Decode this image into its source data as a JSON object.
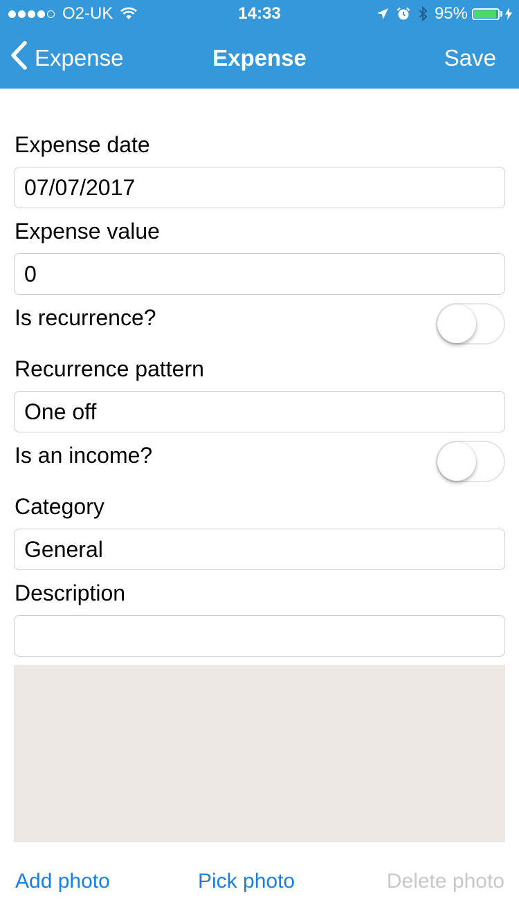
{
  "status_bar": {
    "carrier": "O2-UK",
    "time": "14:33",
    "battery": "95%",
    "battery_level": 0.95,
    "signal_bars": 4,
    "icons": [
      "signal-dots-icon",
      "wifi-icon",
      "location-arrow-icon",
      "alarm-icon",
      "bluetooth-icon",
      "battery-icon",
      "charging-bolt-icon"
    ]
  },
  "nav": {
    "back_label": "Expense",
    "title": "Expense",
    "save_label": "Save",
    "background": "#3598db"
  },
  "form": {
    "expense_date_label": "Expense date",
    "expense_date_value": "07/07/2017",
    "expense_value_label": "Expense value",
    "expense_value_value": "0",
    "is_recurrence_label": "Is recurrence?",
    "is_recurrence_on": false,
    "recurrence_pattern_label": "Recurrence pattern",
    "recurrence_pattern_value": "One off",
    "is_income_label": "Is an income?",
    "is_income_on": false,
    "category_label": "Category",
    "category_value": "General",
    "description_label": "Description",
    "description_value": ""
  },
  "photo": {
    "placeholder_color": "#ede8e4",
    "add_label": "Add photo",
    "pick_label": "Pick photo",
    "delete_label": "Delete photo",
    "action_color": "#1a7fe0",
    "disabled_color": "#c8c8c8"
  }
}
